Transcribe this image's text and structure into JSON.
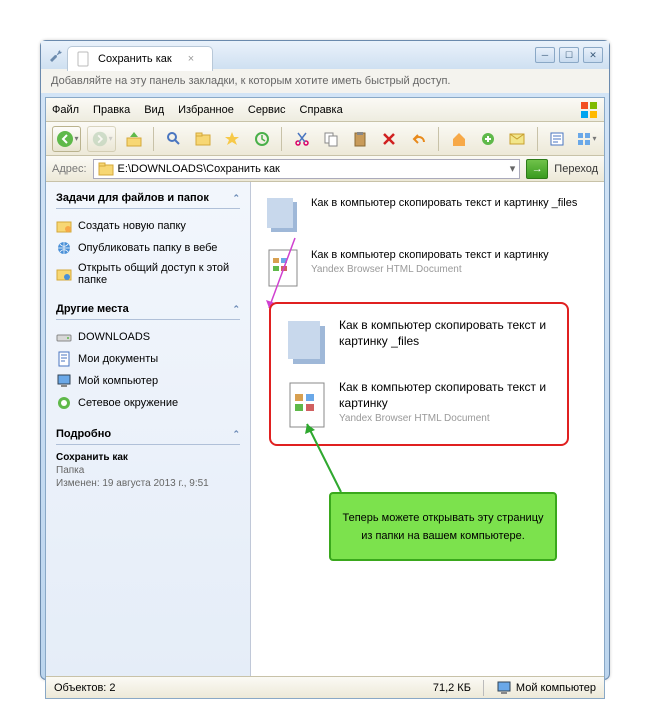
{
  "tab": {
    "title": "Сохранить как"
  },
  "addbar": {
    "text": "Добавляйте на эту панель закладки, к которым хотите иметь быстрый доступ."
  },
  "menu": {
    "file": "Файл",
    "edit": "Правка",
    "view": "Вид",
    "fav": "Избранное",
    "tools": "Сервис",
    "help": "Справка"
  },
  "address": {
    "label": "Адрес:",
    "value": "E:\\DOWNLOADS\\Сохранить как",
    "go": "Переход"
  },
  "side": {
    "tasks": {
      "title": "Задачи для файлов и папок",
      "items": [
        {
          "icon": "folder-new",
          "label": "Создать новую папку"
        },
        {
          "icon": "globe",
          "label": "Опубликовать папку в вебе"
        },
        {
          "icon": "share",
          "label": "Открыть общий доступ к этой папке"
        }
      ]
    },
    "other": {
      "title": "Другие места",
      "items": [
        {
          "icon": "drive",
          "label": "DOWNLOADS"
        },
        {
          "icon": "docs",
          "label": "Мои документы"
        },
        {
          "icon": "computer",
          "label": "Мой компьютер"
        },
        {
          "icon": "network",
          "label": "Сетевое окружение"
        }
      ]
    },
    "details": {
      "title": "Подробно",
      "name": "Сохранить как",
      "type": "Папка",
      "modified": "Изменен: 19 августа 2013 г., 9:51"
    }
  },
  "files": [
    {
      "name": "Как в компьютер скопировать текст и картинку _files",
      "sub": "",
      "type": "folder"
    },
    {
      "name": "Как в компьютер скопировать текст и картинку",
      "sub": "Yandex Browser HTML Document",
      "type": "html"
    }
  ],
  "callout_files": [
    {
      "name": "Как в компьютер скопировать текст и картинку _files",
      "sub": "",
      "type": "folder"
    },
    {
      "name": "Как в компьютер скопировать текст и картинку",
      "sub": "Yandex Browser HTML Document",
      "type": "html"
    }
  ],
  "note": {
    "text": "Теперь можете открывать эту страницу из папки на вашем компьютере."
  },
  "status": {
    "objects": "Объектов: 2",
    "size": "71,2 КБ",
    "location": "Мой компьютер"
  }
}
